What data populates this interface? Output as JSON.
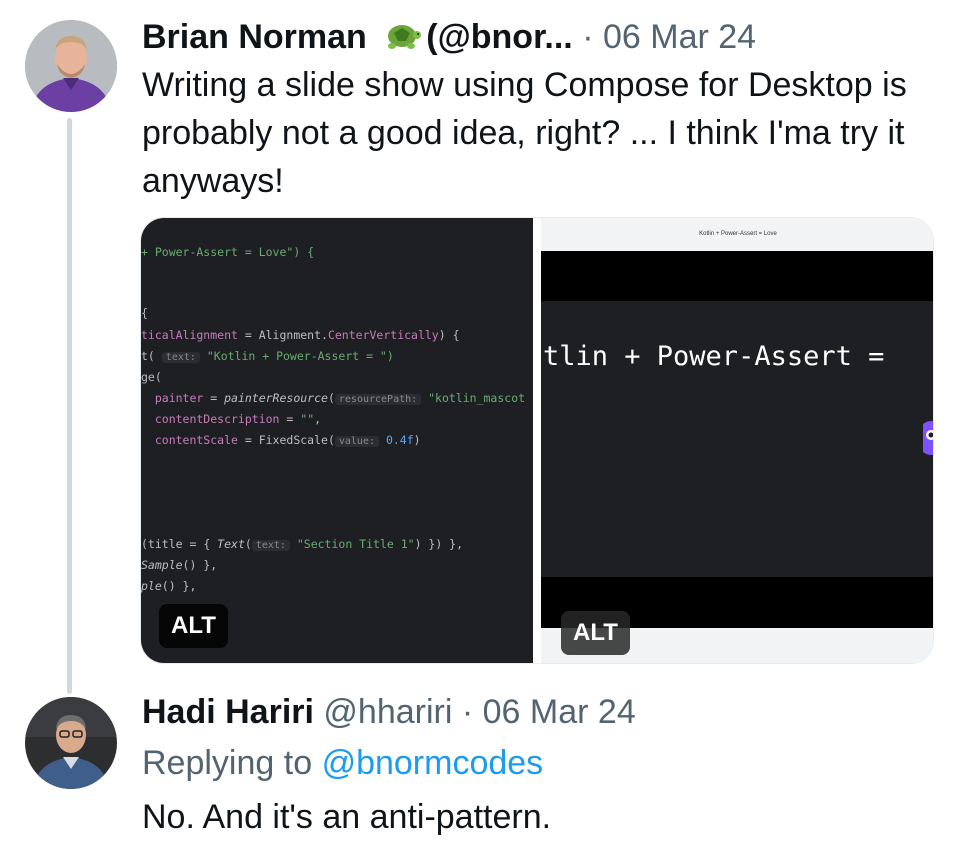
{
  "tweets": [
    {
      "author_name": "Brian Norman",
      "handle": "(@bnor...",
      "separator": "·",
      "date": "06 Mar 24",
      "text": "Writing a slide show using Compose for Desktop is probably not a good idea, right? ... I think I'ma try it anyways!",
      "badge_icon": "turtle-emoji-icon"
    },
    {
      "author_name": "Hadi Hariri",
      "handle": "@hhariri",
      "separator": "·",
      "date": "06 Mar 24",
      "replying_label": "Replying to",
      "replying_handle": "@bnormcodes",
      "text": "No. And it's an anti-pattern."
    }
  ],
  "media": {
    "alt_label": "ALT",
    "code_lines": {
      "l1a": "+ Power-Assert = Love\") {",
      "l2": "{",
      "l3a": "ticalAlignment",
      "l3b": " = Alignment.",
      "l3c": "CenterVertically",
      "l3d": ") {",
      "l4a": "t(",
      "l4hint": "text:",
      "l4b": "\"Kotlin + Power-Assert = \")",
      "l5": "ge(",
      "l6a": "  painter",
      "l6b": " = ",
      "l6c": "painterResource",
      "l6d": "(",
      "l6hint": "resourcePath:",
      "l6e": "\"kotlin_mascot",
      "l7a": "  contentDescription",
      "l7b": " = ",
      "l7c": "\"\"",
      "l7d": ",",
      "l8a": "  contentScale",
      "l8b": " = FixedScale(",
      "l8hint": "value:",
      "l8c": "0.4f",
      "l8d": ")",
      "l9a": "(title",
      "l9b": " = { ",
      "l9c": "Text",
      "l9d": "(",
      "l9hint": "text:",
      "l9e": "\"Section Title 1\"",
      "l9f": ") }) },",
      "l10a": "Sample",
      "l10b": "() },",
      "l11a": "ple",
      "l11b": "() },"
    },
    "window_title": "Kotlin + Power-Assert = Love",
    "slide_text": "tlin + Power-Assert ="
  },
  "colors": {
    "link": "#1d9bf0",
    "muted": "#536471",
    "thread_line": "#cfd9de",
    "editor_bg": "#1e1f22"
  }
}
